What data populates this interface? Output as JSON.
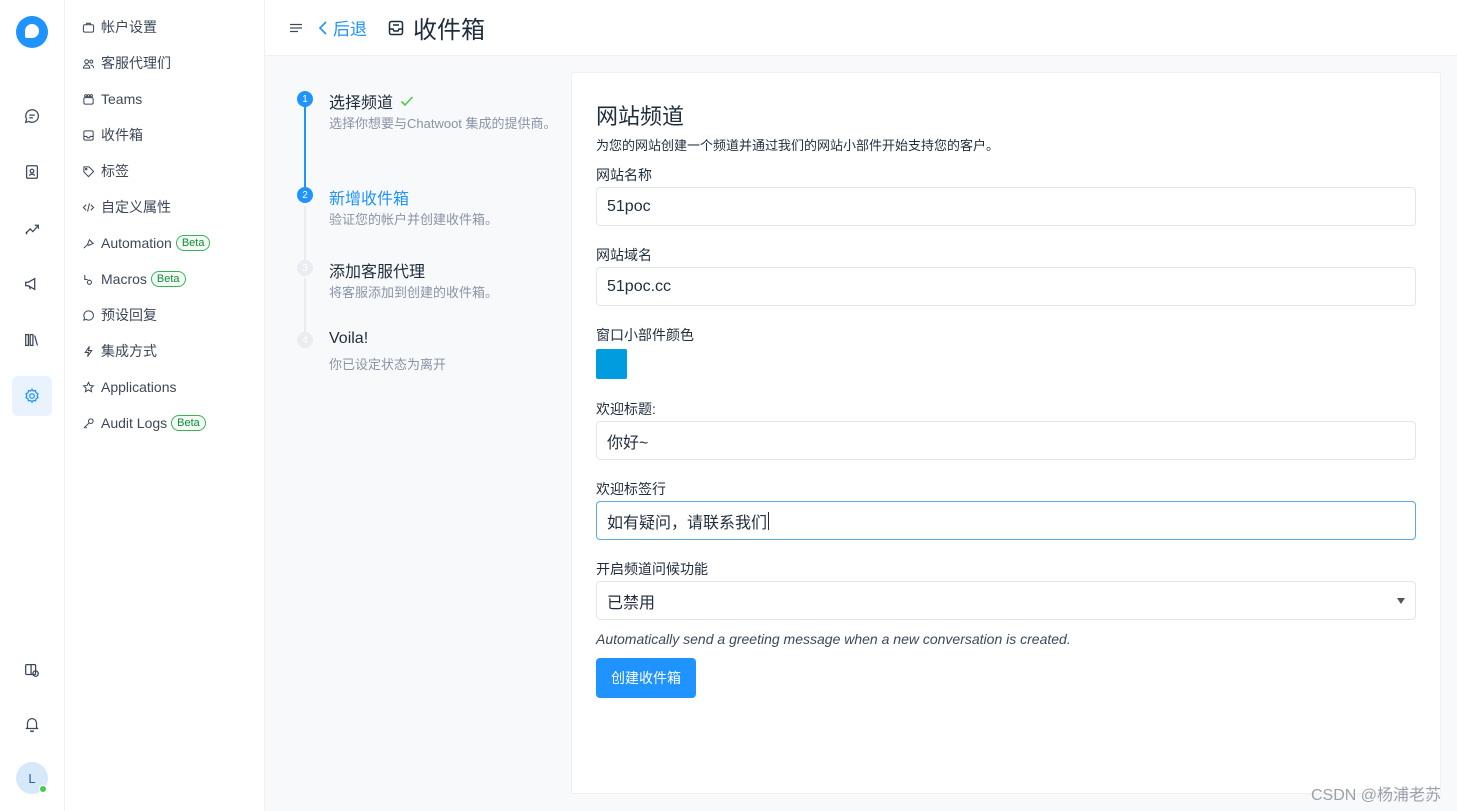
{
  "rail": {
    "items": [
      "conversations",
      "contacts",
      "reports",
      "campaigns",
      "library",
      "settings"
    ],
    "bottom_items": [
      "help-center",
      "notifications"
    ],
    "avatar_initial": "L",
    "avatar_status_color": "#44ce4b",
    "accent": "#1f93ff"
  },
  "sidebar": {
    "items": [
      {
        "label": "帐户设置",
        "icon": "briefcase-icon"
      },
      {
        "label": "客服代理们",
        "icon": "people-icon"
      },
      {
        "label": "Teams",
        "icon": "team-icon"
      },
      {
        "label": "收件箱",
        "icon": "inbox-icon"
      },
      {
        "label": "标签",
        "icon": "tag-icon"
      },
      {
        "label": "自定义属性",
        "icon": "code-icon"
      },
      {
        "label": "Automation",
        "icon": "automation-icon",
        "badge": "Beta"
      },
      {
        "label": "Macros",
        "icon": "macros-icon",
        "badge": "Beta"
      },
      {
        "label": "预设回复",
        "icon": "chat-icon"
      },
      {
        "label": "集成方式",
        "icon": "flash-icon"
      },
      {
        "label": "Applications",
        "icon": "star-icon"
      },
      {
        "label": "Audit Logs",
        "icon": "key-icon",
        "badge": "Beta"
      }
    ]
  },
  "header": {
    "back_label": "后退",
    "title": "收件箱"
  },
  "steps": [
    {
      "num": "1",
      "title": "选择频道",
      "desc": "选择你想要与Chatwoot 集成的提供商。",
      "state": "done"
    },
    {
      "num": "2",
      "title": "新增收件箱",
      "desc": "验证您的帐户并创建收件箱。",
      "state": "active"
    },
    {
      "num": "3",
      "title": "添加客服代理",
      "desc": "将客服添加到创建的收件箱。",
      "state": "pending"
    },
    {
      "num": "4",
      "title": "Voila!",
      "desc": "你已设定状态为离开",
      "state": "pending"
    }
  ],
  "form": {
    "title": "网站频道",
    "subtitle": "为您的网站创建一个频道并通过我们的网站小部件开始支持您的客户。",
    "name_label": "网站名称",
    "name_value": "51poc",
    "domain_label": "网站域名",
    "domain_value": "51poc.cc",
    "color_label": "窗口小部件颜色",
    "widget_color": "#009ce0",
    "welcome_title_label": "欢迎标题:",
    "welcome_title_value": "你好~",
    "tagline_label": "欢迎标签行",
    "tagline_value": "如有疑问，请联系我们",
    "greeting_label": "开启频道问候功能",
    "greeting_value": "已禁用",
    "greeting_help": "Automatically send a greeting message when a new conversation is created.",
    "submit_label": "创建收件箱"
  },
  "watermark": "CSDN @杨浦老苏"
}
